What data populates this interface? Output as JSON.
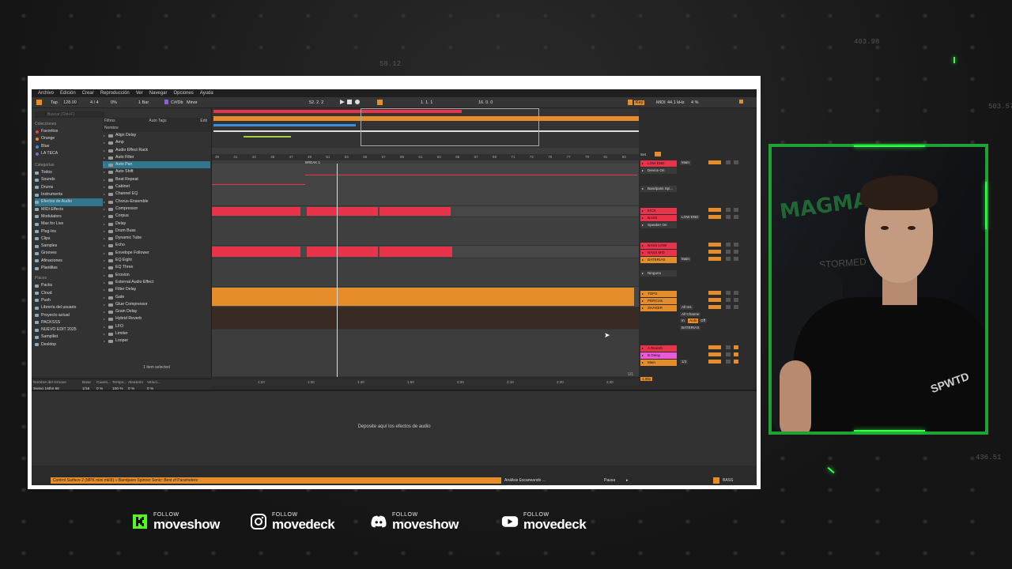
{
  "background": {
    "numbers": [
      "58.12",
      "403.98",
      "436.51",
      "503.57"
    ]
  },
  "daw": {
    "menu": [
      "Archivo",
      "Edición",
      "Crear",
      "Reproducción",
      "Ver",
      "Navegar",
      "Opciones",
      "Ayuda"
    ],
    "transport": {
      "tap": "Tap",
      "tempo": "128.00",
      "meter": "4 / 4",
      "pct": "0%",
      "quant": "1 Bar",
      "key": "C#/Db",
      "scale": "Minor",
      "position": "52. 2. 2",
      "loop_start": "1. 1. 1",
      "loop_len": "16. 0. 0",
      "key_label": "Key",
      "midi_label": "MIDI",
      "sample_rate": "44.1 kHz",
      "cpu": "4 %"
    },
    "browser": {
      "search_placeholder": "Buscar (Ctrl+F)",
      "collections_head": "Colecciones",
      "collections": [
        {
          "label": "Favoritos",
          "color": "#e0443a"
        },
        {
          "label": "Orange",
          "color": "#e58d2b"
        },
        {
          "label": "Blue",
          "color": "#3b8de0"
        },
        {
          "label": "LA TECA",
          "color": "#8a63d2"
        }
      ],
      "categories_head": "Categorías",
      "categories": [
        "Todos",
        "Sounds",
        "Drums",
        "Instruments",
        "Efectos de Audio",
        "MIDI Effects",
        "Modulators",
        "Max for Live",
        "Plug-Ins",
        "Clips",
        "Samples",
        "Grooves",
        "Afinaciones",
        "Plantillas"
      ],
      "places_head": "Places",
      "places": [
        "Packs",
        "Cloud",
        "Push",
        "Librería del usuario",
        "Proyecto actual",
        "PACKSSS",
        "NUEVO EDIT 2025",
        "Sampllist",
        "Desktop"
      ],
      "list_head": "Nombre",
      "filter_label": "Filtros",
      "auto_tags": "Auto Tags",
      "edit": "Edit",
      "items": [
        "Align Delay",
        "Amp",
        "Audio Effect Rack",
        "Auto Filter",
        "Auto Pan",
        "Auto Shift",
        "Beat Repeat",
        "Cabinet",
        "Channel EQ",
        "Chorus-Ensemble",
        "Compressor",
        "Corpus",
        "Delay",
        "Drum Buss",
        "Dynamic Tube",
        "Echo",
        "Envelope Follower",
        "EQ Eight",
        "EQ Three",
        "Erosion",
        "External Audio Effect",
        "Filter Delay",
        "Gate",
        "Glue Compressor",
        "Grain Delay",
        "Hybrid Reverb",
        "LFO",
        "Limiter",
        "Looper"
      ],
      "footer": "1 item selected"
    },
    "groove": {
      "headers": [
        "Nombre del Groove",
        "Base",
        "Cuanti...",
        "Tempo...",
        "Aleatorio",
        "Veloci..."
      ],
      "values": [
        "Swing 16ths 66",
        "1/16",
        "0 %",
        "100 %",
        "0 %",
        "0 %"
      ],
      "pool": "Groove Pool",
      "global_label": "Cantidad Global",
      "global_value": "0%"
    },
    "arrangement": {
      "locator": "BREAK 1",
      "bars": [
        "39",
        "41",
        "43",
        "45",
        "47",
        "49",
        "51",
        "53",
        "55",
        "57",
        "59",
        "61",
        "63",
        "65",
        "67",
        "69",
        "71",
        "73",
        "75",
        "77",
        "79",
        "81",
        "83"
      ],
      "times": [
        "1:20",
        "1:30",
        "1:40",
        "1:50",
        "2:00",
        "2:10",
        "2:20",
        "2:30"
      ],
      "page": "1/1"
    },
    "mixer": {
      "set_label": "Set",
      "tracks": [
        {
          "name": "LOW END",
          "color": "#e8334a",
          "row": 0
        },
        {
          "name": "Device On",
          "color": "#3a3a3a",
          "row": 1
        },
        {
          "name": "Bandpass Spi...",
          "color": "#3a3a3a",
          "row": 2
        },
        {
          "name": "KICK",
          "color": "#e8334a",
          "row": 3
        },
        {
          "name": "BASS",
          "color": "#e8334a",
          "row": 4
        },
        {
          "name": "Speaker On",
          "color": "#3a3a3a",
          "row": 5
        },
        {
          "name": "BASS LOW",
          "color": "#e8334a",
          "row": 6
        },
        {
          "name": "BASS MID",
          "color": "#e8334a",
          "row": 7
        },
        {
          "name": "BATERIAS",
          "color": "#e58d2b",
          "row": 8
        },
        {
          "name": "Ninguno",
          "color": "#3a3a3a",
          "row": 9
        },
        {
          "name": "TOPS",
          "color": "#e58d2b",
          "row": 10
        },
        {
          "name": "PERCUS",
          "color": "#e58d2b",
          "row": 11
        },
        {
          "name": "SHAKER",
          "color": "#e58d2b",
          "row": 12
        },
        {
          "name": "A Reverb",
          "color": "#e8334a",
          "row": 13
        },
        {
          "name": "B Delay",
          "color": "#e85ad8",
          "row": 14
        },
        {
          "name": "Main",
          "color": "#e58d2b",
          "row": 15
        }
      ],
      "io_values": [
        "Main",
        "LOW END",
        "Main",
        "All Ins",
        "All Channe",
        "BATERIAS",
        "1/2"
      ],
      "main_ratio": "1.00x",
      "in_label": "In",
      "auto_label": "Auto",
      "off_label": "Off"
    },
    "device_drop": "Deposite aquí los efectos de audio",
    "status": "Control Surface 2 (MPK mini mkIII) » Bandpass Spinner Sonic: Best of Parameters",
    "analysis": "Análisis Escaneando ...",
    "pause": "Pausa",
    "status_track": "BASS"
  },
  "social": [
    {
      "platform": "kick",
      "follow": "FOLLOW",
      "handle": "moveshow",
      "color": "#53fc18"
    },
    {
      "platform": "instagram",
      "follow": "FOLLOW",
      "handle": "movedeck",
      "color": "#ffffff"
    },
    {
      "platform": "discord",
      "follow": "FOLLOW",
      "handle": "moveshow",
      "color": "#ffffff"
    },
    {
      "platform": "youtube",
      "follow": "FOLLOW",
      "handle": "movedeck",
      "color": "#ffffff"
    }
  ],
  "webcam": {
    "backdrop_text_1": "MAGMA",
    "backdrop_text_2": "STORMED",
    "shirt_text": "SPWTD"
  },
  "colors": {
    "accent_orange": "#e58d2b",
    "accent_red": "#e8334a",
    "selection_blue": "#31768c",
    "neon_green": "#36ff4a"
  }
}
